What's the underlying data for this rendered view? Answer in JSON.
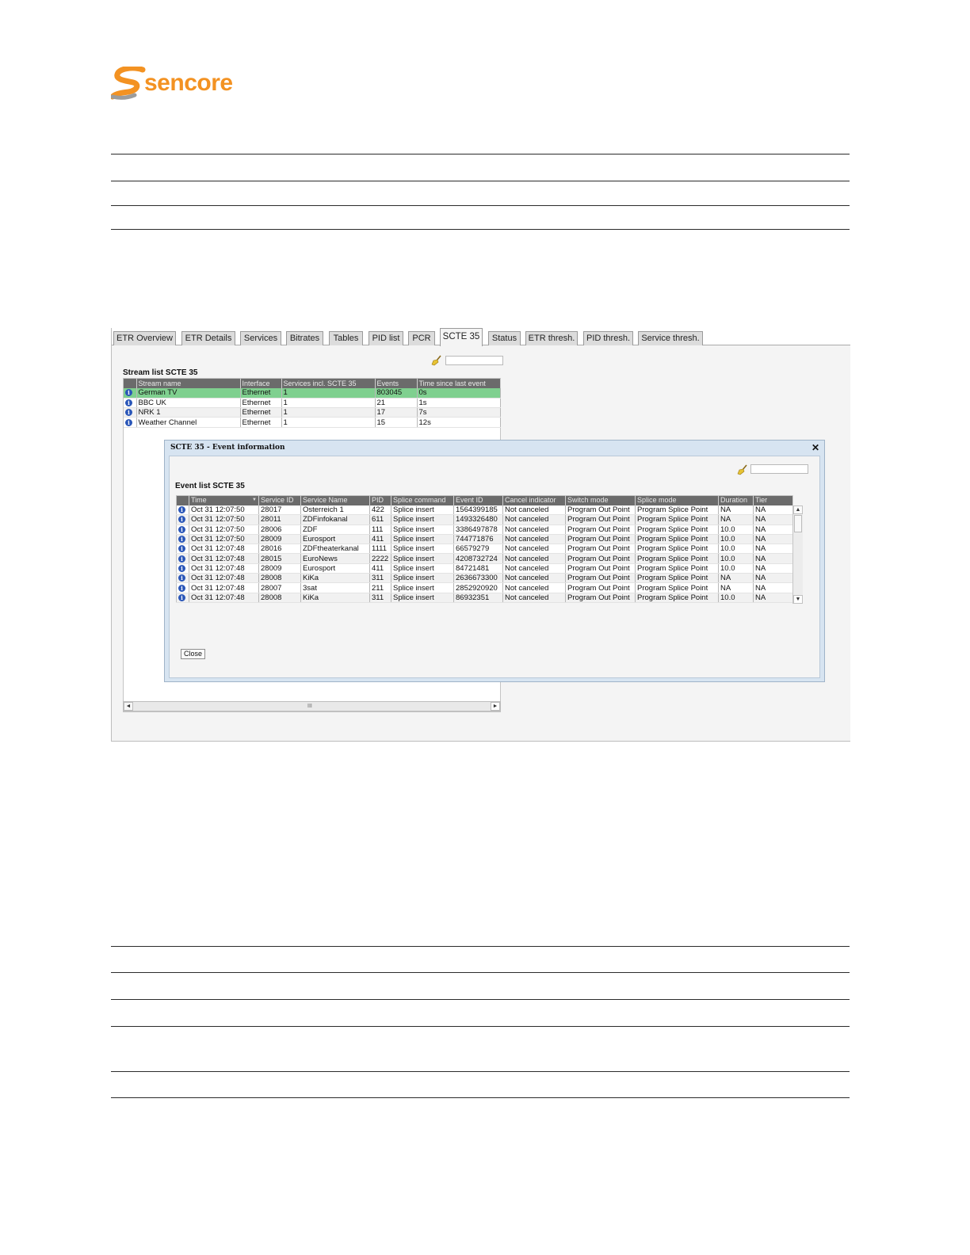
{
  "logo": {
    "text": "sencore",
    "color": "#f39222"
  },
  "tabs": [
    {
      "label": "ETR Overview"
    },
    {
      "label": "ETR Details"
    },
    {
      "label": "Services"
    },
    {
      "label": "Bitrates"
    },
    {
      "label": "Tables"
    },
    {
      "label": "PID list"
    },
    {
      "label": "PCR"
    },
    {
      "label": "SCTE 35"
    },
    {
      "label": "Status"
    },
    {
      "label": "ETR thresh."
    },
    {
      "label": "PID thresh."
    },
    {
      "label": "Service thresh."
    }
  ],
  "active_tab": "SCTE 35",
  "stream_list": {
    "title": "Stream list SCTE 35",
    "filter_value": "",
    "columns": [
      "Stream name",
      "Interface",
      "Services incl. SCTE 35",
      "Events",
      "Time since last event"
    ],
    "rows": [
      [
        "German TV",
        "Ethernet",
        "1",
        "803045",
        "0s"
      ],
      [
        "BBC UK",
        "Ethernet",
        "1",
        "21",
        "1s"
      ],
      [
        "NRK 1",
        "Ethernet",
        "1",
        "17",
        "7s"
      ],
      [
        "Weather Channel",
        "Ethernet",
        "1",
        "15",
        "12s"
      ]
    ],
    "selected_row": 0
  },
  "hscroll_grip": "III",
  "dialog": {
    "title": "SCTE 35 - Event information",
    "close_glyph": "✕",
    "list_title": "Event list SCTE 35",
    "filter_value": "",
    "sort_indicator": "▼",
    "columns": [
      "Time",
      "Service ID",
      "Service Name",
      "PID",
      "Splice command",
      "Event ID",
      "Cancel indicator",
      "Switch mode",
      "Splice mode",
      "Duration",
      "Tier"
    ],
    "rows": [
      [
        "Oct 31 12:07:50",
        "28017",
        "Osterreich 1",
        "422",
        "Splice insert",
        "1564399185",
        "Not canceled",
        "Program Out Point",
        "Program Splice Point",
        "NA",
        "NA"
      ],
      [
        "Oct 31 12:07:50",
        "28011",
        "ZDFinfokanal",
        "611",
        "Splice insert",
        "1493326480",
        "Not canceled",
        "Program Out Point",
        "Program Splice Point",
        "NA",
        "NA"
      ],
      [
        "Oct 31 12:07:50",
        "28006",
        "ZDF",
        "111",
        "Splice insert",
        "3386497878",
        "Not canceled",
        "Program Out Point",
        "Program Splice Point",
        "10.0",
        "NA"
      ],
      [
        "Oct 31 12:07:50",
        "28009",
        "Eurosport",
        "411",
        "Splice insert",
        "744771876",
        "Not canceled",
        "Program Out Point",
        "Program Splice Point",
        "10.0",
        "NA"
      ],
      [
        "Oct 31 12:07:48",
        "28016",
        "ZDFtheaterkanal",
        "1111",
        "Splice insert",
        "66579279",
        "Not canceled",
        "Program Out Point",
        "Program Splice Point",
        "10.0",
        "NA"
      ],
      [
        "Oct 31 12:07:48",
        "28015",
        "EuroNews",
        "2222",
        "Splice insert",
        "4208732724",
        "Not canceled",
        "Program Out Point",
        "Program Splice Point",
        "10.0",
        "NA"
      ],
      [
        "Oct 31 12:07:48",
        "28009",
        "Eurosport",
        "411",
        "Splice insert",
        "84721481",
        "Not canceled",
        "Program Out Point",
        "Program Splice Point",
        "10.0",
        "NA"
      ],
      [
        "Oct 31 12:07:48",
        "28008",
        "KiKa",
        "311",
        "Splice insert",
        "2636673300",
        "Not canceled",
        "Program Out Point",
        "Program Splice Point",
        "NA",
        "NA"
      ],
      [
        "Oct 31 12:07:48",
        "28007",
        "3sat",
        "211",
        "Splice insert",
        "2852920920",
        "Not canceled",
        "Program Out Point",
        "Program Splice Point",
        "NA",
        "NA"
      ],
      [
        "Oct 31 12:07:48",
        "28008",
        "KiKa",
        "311",
        "Splice insert",
        "86932351",
        "Not canceled",
        "Program Out Point",
        "Program Splice Point",
        "10.0",
        "NA"
      ]
    ],
    "close_label": "Close"
  },
  "icons": {
    "info": "info-icon",
    "filter_clear": "broom-icon"
  },
  "info_glyph": "i",
  "scroll_glyphs": {
    "up": "▲",
    "down": "▼",
    "left": "◄",
    "right": "►"
  },
  "colors": {
    "selected_row": "#7fd08f",
    "header_bg": "#6b6b6b",
    "dialog_frame": "#d7e4f1",
    "info_icon": "#2a56b8"
  }
}
